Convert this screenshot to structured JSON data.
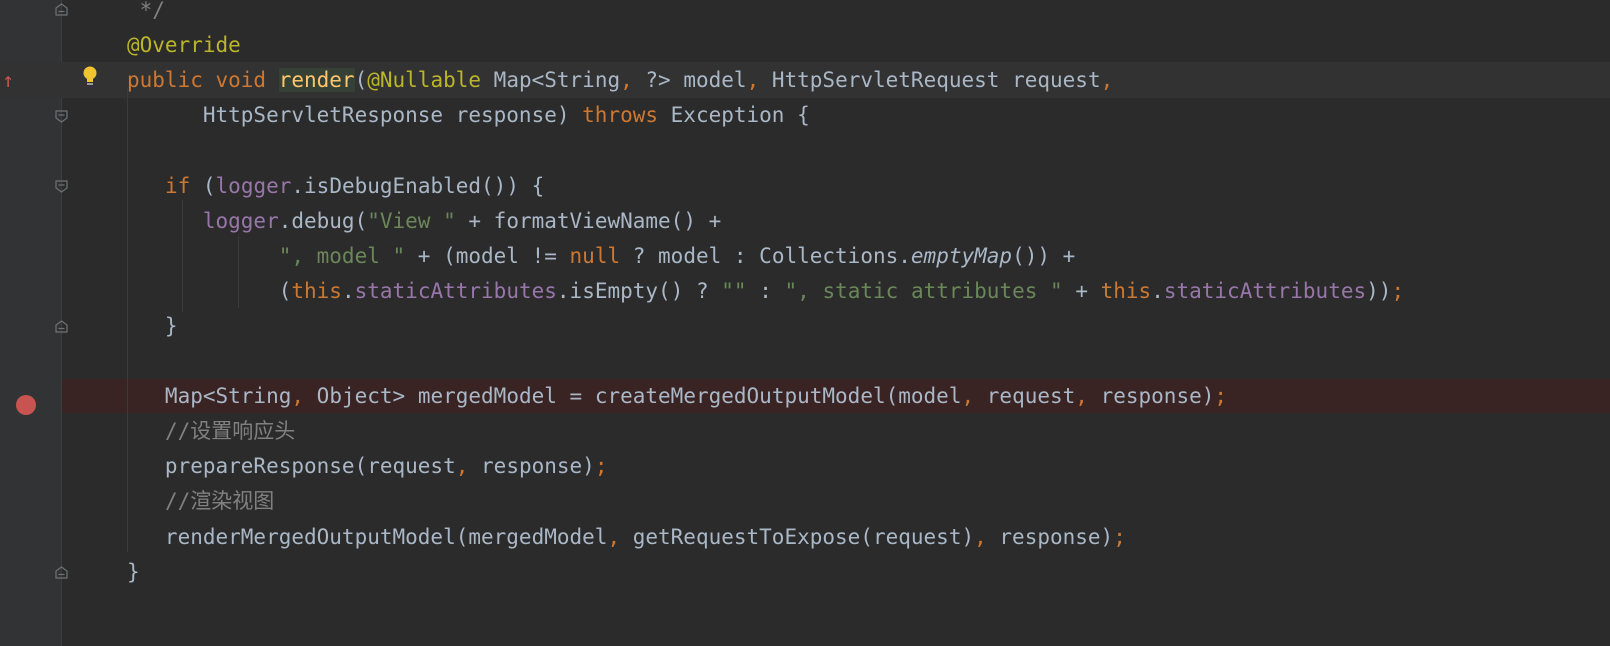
{
  "editor": {
    "lines": [
      {
        "tokens": [
          {
            "t": " */",
            "c": "cmt"
          }
        ]
      },
      {
        "tokens": [
          {
            "t": "@Override",
            "c": "ann"
          }
        ]
      },
      {
        "tokens": [
          {
            "t": "public void ",
            "c": "kw"
          },
          {
            "t": "render",
            "c": "fn"
          },
          {
            "t": "(",
            "c": ""
          },
          {
            "t": "@Nullable",
            "c": "ann"
          },
          {
            "t": " Map<String",
            "c": ""
          },
          {
            "t": ",",
            "c": "kw"
          },
          {
            "t": " ?> model",
            "c": ""
          },
          {
            "t": ",",
            "c": "kw"
          },
          {
            "t": " HttpServletRequest request",
            "c": ""
          },
          {
            "t": ",",
            "c": "kw"
          }
        ]
      },
      {
        "tokens": [
          {
            "t": "      HttpServletResponse response) ",
            "c": ""
          },
          {
            "t": "throws",
            "c": "kw"
          },
          {
            "t": " Exception {",
            "c": ""
          }
        ]
      },
      {
        "tokens": []
      },
      {
        "tokens": [
          {
            "t": "   ",
            "c": ""
          },
          {
            "t": "if",
            "c": "kw"
          },
          {
            "t": " (",
            "c": ""
          },
          {
            "t": "logger",
            "c": "fld"
          },
          {
            "t": ".isDebugEnabled()) {",
            "c": ""
          }
        ]
      },
      {
        "tokens": [
          {
            "t": "      ",
            "c": ""
          },
          {
            "t": "logger",
            "c": "fld"
          },
          {
            "t": ".debug(",
            "c": ""
          },
          {
            "t": "\"View \"",
            "c": "str"
          },
          {
            "t": " + formatViewName() +",
            "c": ""
          }
        ]
      },
      {
        "tokens": [
          {
            "t": "            ",
            "c": ""
          },
          {
            "t": "\", model \"",
            "c": "str"
          },
          {
            "t": " + (model != ",
            "c": ""
          },
          {
            "t": "null",
            "c": "kw"
          },
          {
            "t": " ? model : Collections.",
            "c": ""
          },
          {
            "t": "emptyMap",
            "c": "it"
          },
          {
            "t": "()) +",
            "c": ""
          }
        ]
      },
      {
        "tokens": [
          {
            "t": "            (",
            "c": ""
          },
          {
            "t": "this",
            "c": "kw"
          },
          {
            "t": ".",
            "c": ""
          },
          {
            "t": "staticAttributes",
            "c": "fld"
          },
          {
            "t": ".isEmpty() ? ",
            "c": ""
          },
          {
            "t": "\"\"",
            "c": "str"
          },
          {
            "t": " : ",
            "c": ""
          },
          {
            "t": "\", static attributes \"",
            "c": "str"
          },
          {
            "t": " + ",
            "c": ""
          },
          {
            "t": "this",
            "c": "kw"
          },
          {
            "t": ".",
            "c": ""
          },
          {
            "t": "staticAttributes",
            "c": "fld"
          },
          {
            "t": "))",
            "c": ""
          },
          {
            "t": ";",
            "c": "kw"
          }
        ]
      },
      {
        "tokens": [
          {
            "t": "   }",
            "c": ""
          }
        ]
      },
      {
        "tokens": []
      },
      {
        "tokens": [
          {
            "t": "   Map<String",
            "c": ""
          },
          {
            "t": ",",
            "c": "kw"
          },
          {
            "t": " Object> mergedModel = createMergedOutputModel(model",
            "c": ""
          },
          {
            "t": ",",
            "c": "kw"
          },
          {
            "t": " request",
            "c": ""
          },
          {
            "t": ",",
            "c": "kw"
          },
          {
            "t": " response)",
            "c": ""
          },
          {
            "t": ";",
            "c": "kw"
          }
        ]
      },
      {
        "tokens": [
          {
            "t": "   ",
            "c": ""
          },
          {
            "t": "//设置响应头",
            "c": "cmt"
          }
        ]
      },
      {
        "tokens": [
          {
            "t": "   prepareResponse(request",
            "c": ""
          },
          {
            "t": ",",
            "c": "kw"
          },
          {
            "t": " response)",
            "c": ""
          },
          {
            "t": ";",
            "c": "kw"
          }
        ]
      },
      {
        "tokens": [
          {
            "t": "   ",
            "c": ""
          },
          {
            "t": "//渲染视图",
            "c": "cmt"
          }
        ]
      },
      {
        "tokens": [
          {
            "t": "   renderMergedOutputModel(mergedModel",
            "c": ""
          },
          {
            "t": ",",
            "c": "kw"
          },
          {
            "t": " getRequestToExpose(request)",
            "c": ""
          },
          {
            "t": ",",
            "c": "kw"
          },
          {
            "t": " response)",
            "c": ""
          },
          {
            "t": ";",
            "c": "kw"
          }
        ]
      },
      {
        "tokens": [
          {
            "t": "}",
            "c": ""
          }
        ]
      }
    ]
  },
  "gutter": {
    "override_marker": "↑",
    "intention_icon": "lightbulb-icon",
    "breakpoint_icon": "breakpoint-icon",
    "fold_icon": "fold-icon"
  },
  "colors": {
    "background": "#2b2b2b",
    "keyword": "#cc7832",
    "annotation": "#bbb529",
    "string": "#6a8759",
    "field": "#9876aa",
    "method_decl": "#ffc66d",
    "comment": "#808080",
    "breakpoint": "#c75450"
  }
}
